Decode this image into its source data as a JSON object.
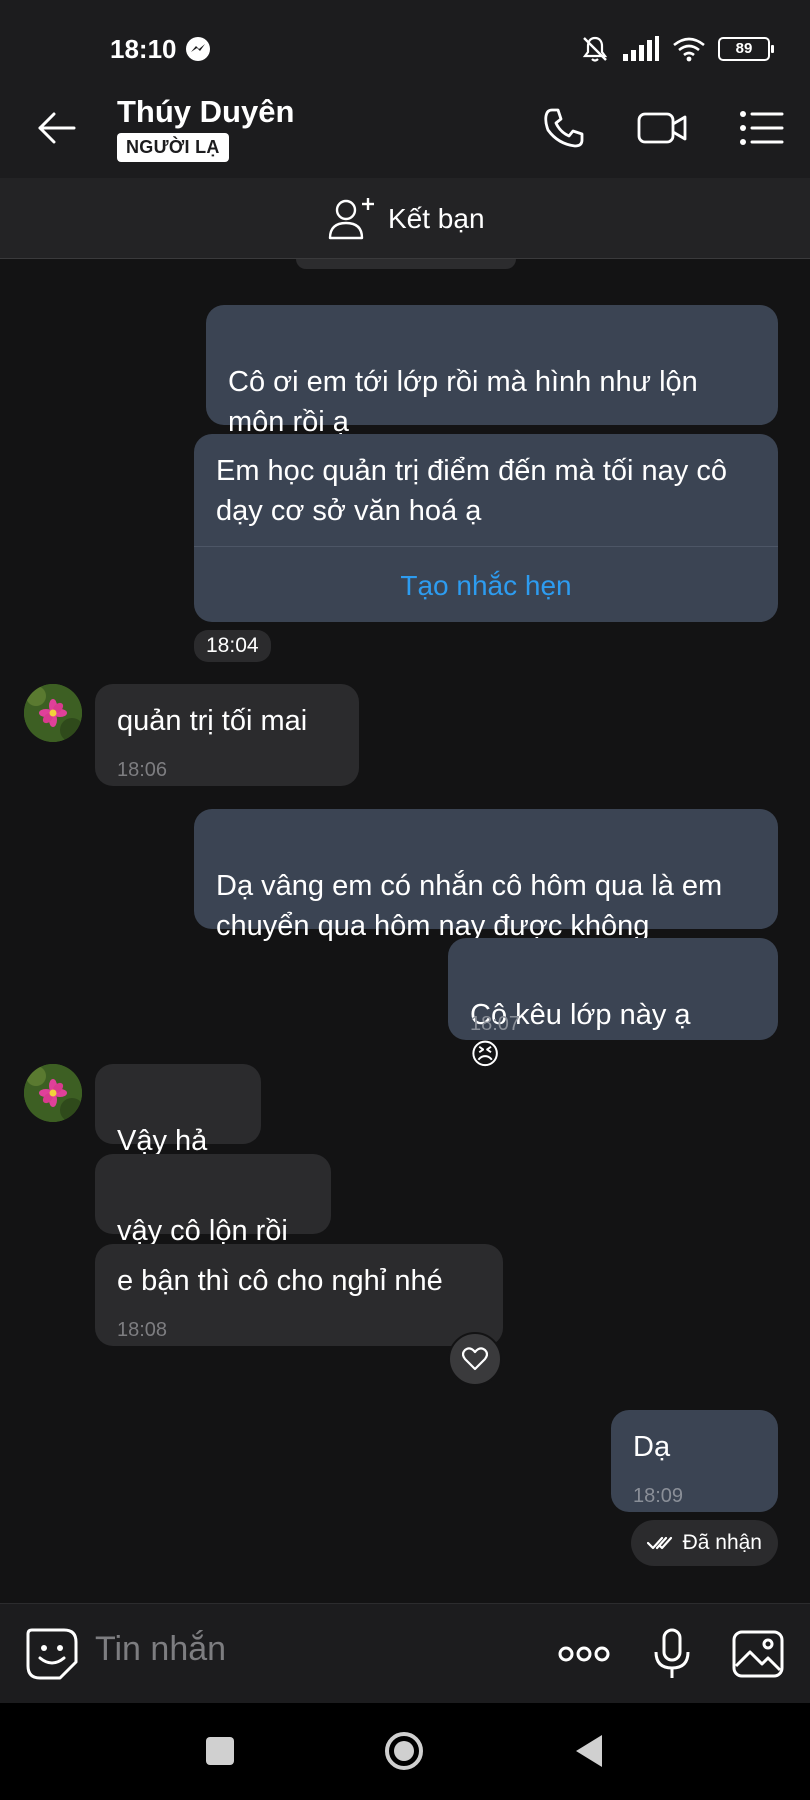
{
  "status_bar": {
    "time": "18:10",
    "battery": "89"
  },
  "header": {
    "name": "Thúy Duyên",
    "badge": "NGƯỜI LẠ"
  },
  "friend_bar": {
    "label": "Kết bạn"
  },
  "messages": {
    "m1": "Cô ơi em tới lớp rồi mà hình như lộn môn rồi ạ",
    "m2": "Em học quản trị điểm đến mà tối nay cô dạy cơ sở văn hoá ạ",
    "m2_action": "Tạo nhắc hẹn",
    "t1": "18:04",
    "m3": "quản trị tối mai",
    "m3_time": "18:06",
    "m4": "Dạ vâng em có nhắn cô hôm qua là em chuyển qua hôm nay được không",
    "m5": "Cô kêu lớp này ạ",
    "m5_emoji": "😣",
    "m5_time": "18:07",
    "m6": "Vậy hả",
    "m7": "vậy cô lộn rồi",
    "m8": "e bận thì cô cho nghỉ nhé",
    "m8_time": "18:08",
    "m9": "Dạ",
    "m9_time": "18:09"
  },
  "delivery_status": "Đã nhận",
  "composer": {
    "placeholder": "Tin nhắn"
  },
  "colors": {
    "outgoing_bubble": "#3b4453",
    "incoming_bubble": "#2b2b2d",
    "link": "#2d9cf0",
    "background": "#131314"
  },
  "icons": [
    "back-arrow-icon",
    "phone-icon",
    "video-camera-icon",
    "menu-list-icon",
    "add-person-icon",
    "heart-icon",
    "double-check-icon",
    "emoji-sticker-icon",
    "more-dots-icon",
    "microphone-icon",
    "gallery-icon"
  ]
}
